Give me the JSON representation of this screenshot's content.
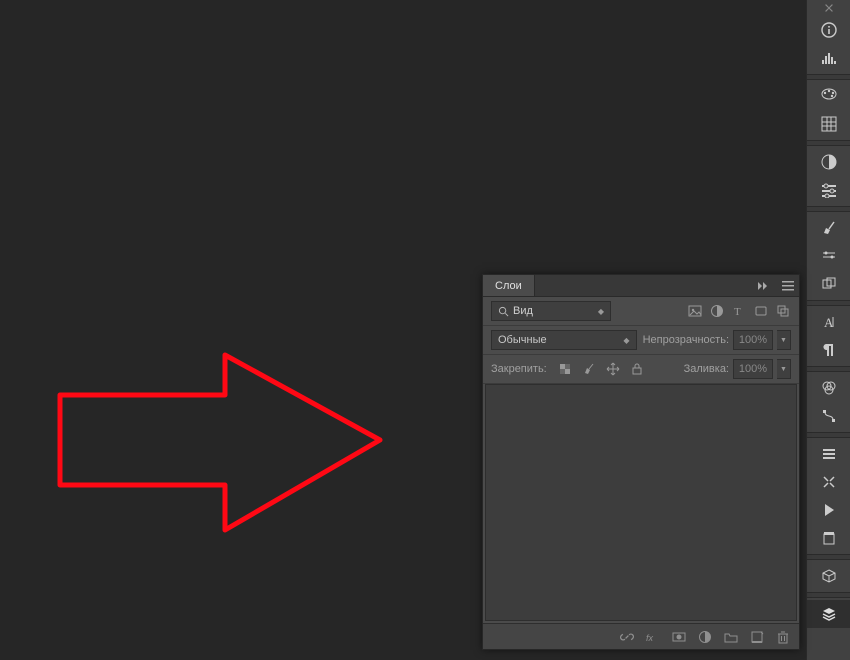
{
  "canvas": {
    "shape": "arrow",
    "stroke": "#ff0814",
    "stroke_width": 5
  },
  "layers_panel": {
    "title": "Слои",
    "filter": {
      "kind_label": "Вид",
      "search_icon": "search-icon"
    },
    "filter_buttons": [
      "image-filter",
      "adjust-filter",
      "type-filter",
      "shape-filter",
      "smart-filter"
    ],
    "blend_mode": "Обычные",
    "opacity": {
      "label": "Непрозрачность:",
      "value": "100%"
    },
    "lock": {
      "label": "Закрепить:"
    },
    "fill": {
      "label": "Заливка:",
      "value": "100%"
    },
    "footer_icons": [
      "link",
      "fx",
      "mask",
      "adjust",
      "group",
      "new",
      "trash"
    ]
  },
  "right_toolbar": {
    "icons": [
      "collapse",
      "info",
      "histogram",
      "swatches",
      "grid",
      "contrast",
      "adjustments",
      "brush",
      "brush-options",
      "clone-panel",
      "character",
      "paragraph",
      "channels",
      "paths",
      "actions",
      "tools",
      "play",
      "save-options",
      "3d",
      "layers"
    ]
  }
}
